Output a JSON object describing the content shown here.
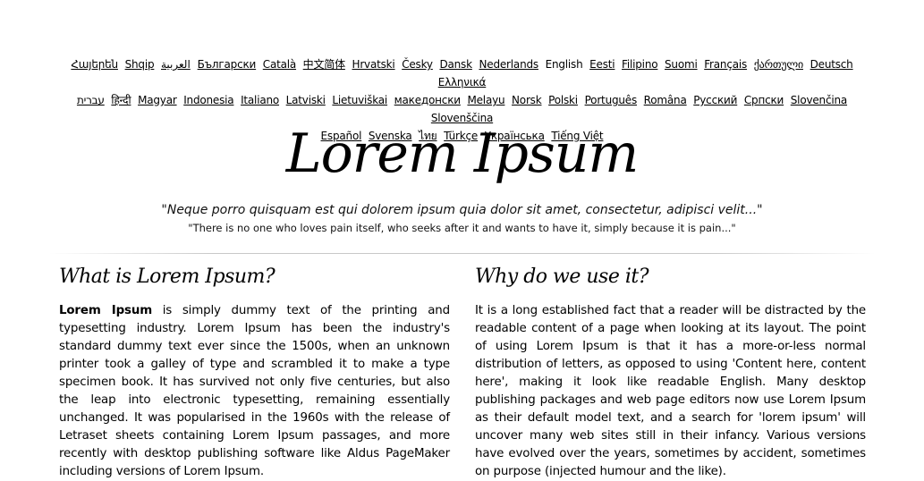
{
  "languages": {
    "row1": [
      {
        "label": "Հայերեն",
        "current": false
      },
      {
        "label": "Shqip",
        "current": false
      },
      {
        "label": "العربية",
        "current": false
      },
      {
        "label": "Български",
        "current": false
      },
      {
        "label": "Català",
        "current": false
      },
      {
        "label": "中文简体",
        "current": false
      },
      {
        "label": "Hrvatski",
        "current": false
      },
      {
        "label": "Česky",
        "current": false
      },
      {
        "label": "Dansk",
        "current": false
      },
      {
        "label": "Nederlands",
        "current": false
      },
      {
        "label": "English",
        "current": true
      },
      {
        "label": "Eesti",
        "current": false
      },
      {
        "label": "Filipino",
        "current": false
      },
      {
        "label": "Suomi",
        "current": false
      },
      {
        "label": "Français",
        "current": false
      },
      {
        "label": "ქართული",
        "current": false
      },
      {
        "label": "Deutsch",
        "current": false
      },
      {
        "label": "Ελληνικά",
        "current": false
      }
    ],
    "row2": [
      {
        "label": "עברית",
        "current": false
      },
      {
        "label": "हिन्दी",
        "current": false
      },
      {
        "label": "Magyar",
        "current": false
      },
      {
        "label": "Indonesia",
        "current": false
      },
      {
        "label": "Italiano",
        "current": false
      },
      {
        "label": "Latviski",
        "current": false
      },
      {
        "label": "Lietuviškai",
        "current": false
      },
      {
        "label": "македонски",
        "current": false
      },
      {
        "label": "Melayu",
        "current": false
      },
      {
        "label": "Norsk",
        "current": false
      },
      {
        "label": "Polski",
        "current": false
      },
      {
        "label": "Português",
        "current": false
      },
      {
        "label": "Româna",
        "current": false
      },
      {
        "label": "Pyccкий",
        "current": false
      },
      {
        "label": "Српски",
        "current": false
      },
      {
        "label": "Slovenčina",
        "current": false
      },
      {
        "label": "Slovenščina",
        "current": false
      }
    ],
    "row3": [
      {
        "label": "Español",
        "current": false
      },
      {
        "label": "Svenska",
        "current": false
      },
      {
        "label": "ไทย",
        "current": false
      },
      {
        "label": "Türkçe",
        "current": false
      },
      {
        "label": "Українська",
        "current": false
      },
      {
        "label": "Tiếng Việt",
        "current": false
      }
    ]
  },
  "banner": {
    "title": "Lorem Ipsum",
    "quote_latin": "\"Neque porro quisquam est qui dolorem ipsum quia dolor sit amet, consectetur, adipisci velit...\"",
    "quote_english": "\"There is no one who loves pain itself, who seeks after it and wants to have it, simply because it is pain...\""
  },
  "sections": {
    "what": {
      "heading": "What is Lorem Ipsum?",
      "bold_lead": "Lorem Ipsum",
      "body": " is simply dummy text of the printing and typesetting industry. Lorem Ipsum has been the industry's standard dummy text ever since the 1500s, when an unknown printer took a galley of type and scrambled it to make a type specimen book. It has survived not only five centuries, but also the leap into electronic typesetting, remaining essentially unchanged. It was popularised in the 1960s with the release of Letraset sheets containing Lorem Ipsum passages, and more recently with desktop publishing software like Aldus PageMaker including versions of Lorem Ipsum."
    },
    "why": {
      "heading": "Why do we use it?",
      "body": "It is a long established fact that a reader will be distracted by the readable content of a page when looking at its layout. The point of using Lorem Ipsum is that it has a more-or-less normal distribution of letters, as opposed to using 'Content here, content here', making it look like readable English. Many desktop publishing packages and web page editors now use Lorem Ipsum as their default model text, and a search for 'lorem ipsum' will uncover many web sites still in their infancy. Various versions have evolved over the years, sometimes by accident, sometimes on purpose (injected humour and the like)."
    }
  }
}
